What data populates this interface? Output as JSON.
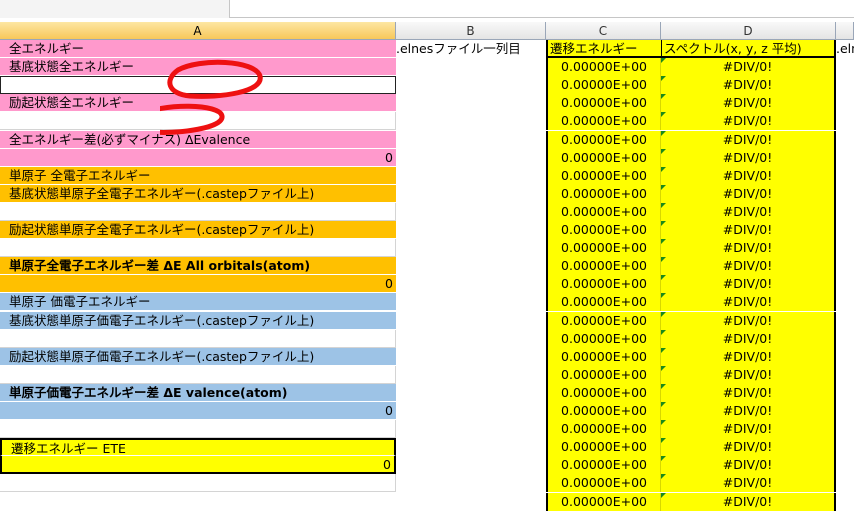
{
  "columns": [
    "A",
    "B",
    "C",
    "D"
  ],
  "cell_b_header": ".elnesファイル一列目",
  "cell_c_header": "遷移エネルギー",
  "cell_d_header": "スペクトル(x, y, z 平均)",
  "cell_e_header_partial": ".eln",
  "col_a": [
    {
      "text": "全エネルギー",
      "fill": "pink"
    },
    {
      "text": "基底状態全エネルギー",
      "fill": "pink"
    },
    {
      "text": "",
      "fill": "white"
    },
    {
      "text": "励起状態全エネルギー",
      "fill": "pink"
    },
    {
      "text": "",
      "fill": "white"
    },
    {
      "text": "全エネルギー差(必ずマイナス) ΔEvalence",
      "fill": "pink",
      "bold_part": "ΔEvalence"
    },
    {
      "text": "0",
      "fill": "pink",
      "align": "right"
    },
    {
      "text": "単原子  全電子エネルギー",
      "fill": "orange"
    },
    {
      "text": "基底状態単原子全電子エネルギー(.castepファイル上)",
      "fill": "orange"
    },
    {
      "text": "",
      "fill": "white"
    },
    {
      "text": "励起状態単原子全電子エネルギー(.castepファイル上)",
      "fill": "orange"
    },
    {
      "text": "",
      "fill": "white"
    },
    {
      "text": "単原子全電子エネルギー差  ΔE All orbitals(atom)",
      "fill": "orange",
      "bold": true
    },
    {
      "text": "0",
      "fill": "orange",
      "align": "right"
    },
    {
      "text": "単原子  価電子エネルギー",
      "fill": "blue"
    },
    {
      "text": "基底状態単原子価電子エネルギー(.castepファイル上)",
      "fill": "blue"
    },
    {
      "text": "",
      "fill": "white"
    },
    {
      "text": "励起状態単原子価電子エネルギー(.castepファイル上)",
      "fill": "blue"
    },
    {
      "text": "",
      "fill": "white"
    },
    {
      "text": "単原子価電子エネルギー差  ΔE valence(atom)",
      "fill": "blue",
      "bold": true
    },
    {
      "text": "0",
      "fill": "blue",
      "align": "right"
    },
    {
      "text": "",
      "fill": "white"
    },
    {
      "text": "遷移エネルギー  ETE",
      "fill": "yellow",
      "bold_part": "ETE"
    },
    {
      "text": "0",
      "fill": "yellow",
      "align": "right"
    },
    {
      "text": "",
      "fill": "white"
    }
  ],
  "col_c_value": "0.00000E+00",
  "col_d_value": "#DIV/0!",
  "row_count": 24,
  "colors": {
    "pink": "#ff99cc",
    "orange": "#ffc000",
    "blue": "#9dc3e6",
    "yellow": "#ffff00",
    "white": "#ffffff",
    "red_mark": "#ee1111"
  }
}
